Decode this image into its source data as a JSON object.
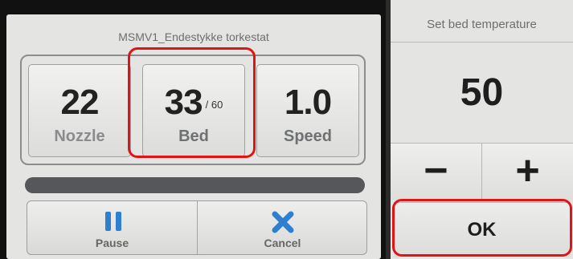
{
  "print_screen": {
    "title": "MSMV1_Endestykke torkestat",
    "nozzle": {
      "value": "22",
      "label": "Nozzle"
    },
    "bed": {
      "value": "33",
      "target": "/ 60",
      "label": "Bed"
    },
    "speed": {
      "value": "1.0",
      "label": "Speed"
    },
    "progress_fraction": 0.0,
    "pause_label": "Pause",
    "cancel_label": "Cancel"
  },
  "bed_dialog": {
    "title": "Set bed temperature",
    "value": "50",
    "minus_label": "−",
    "plus_label": "+",
    "ok_label": "OK"
  },
  "colors": {
    "highlight": "#e01414",
    "accent_icon": "#2f7fd0"
  }
}
